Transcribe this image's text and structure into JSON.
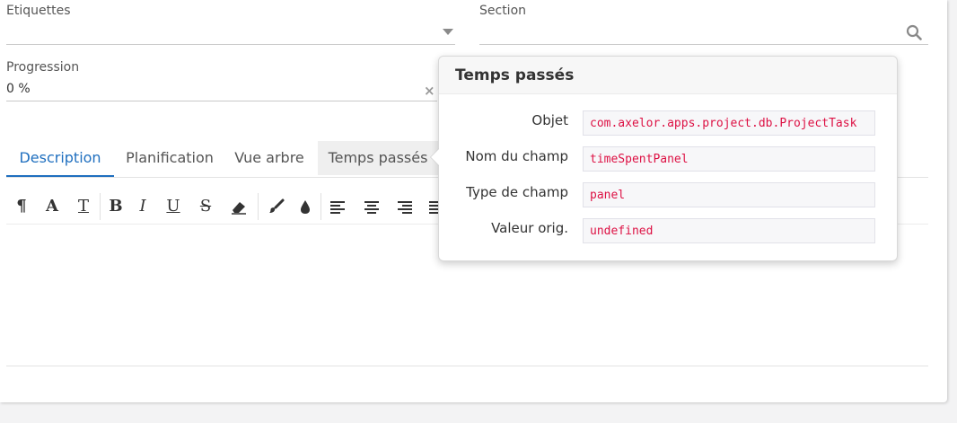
{
  "form": {
    "etiquettes": {
      "label": "Etiquettes",
      "value": ""
    },
    "section": {
      "label": "Section",
      "value": ""
    },
    "progression": {
      "label": "Progression",
      "value": "0 %"
    }
  },
  "tabs": [
    {
      "label": "Description",
      "active": true
    },
    {
      "label": "Planification",
      "active": false
    },
    {
      "label": "Vue arbre",
      "active": false
    },
    {
      "label": "Temps passés",
      "active": false,
      "hover": true
    }
  ],
  "toolbar": {
    "buttons": [
      {
        "name": "paragraph",
        "glyph": "¶"
      },
      {
        "name": "font",
        "glyph": "A"
      },
      {
        "name": "text-style",
        "glyph": "T"
      },
      {
        "name": "bold",
        "glyph": "B"
      },
      {
        "name": "italic",
        "glyph": "I"
      },
      {
        "name": "underline",
        "glyph": "U"
      },
      {
        "name": "strikethrough",
        "glyph": "S"
      },
      {
        "name": "eraser",
        "glyph": ""
      },
      {
        "name": "brush",
        "glyph": ""
      },
      {
        "name": "color-drop",
        "glyph": ""
      },
      {
        "name": "align-left",
        "glyph": ""
      },
      {
        "name": "align-center",
        "glyph": ""
      },
      {
        "name": "align-right",
        "glyph": ""
      },
      {
        "name": "justify",
        "glyph": ""
      }
    ]
  },
  "popover": {
    "title": "Temps passés",
    "rows": [
      {
        "label": "Objet",
        "value": "com.axelor.apps.project.db.ProjectTask"
      },
      {
        "label": "Nom du champ",
        "value": "timeSpentPanel"
      },
      {
        "label": "Type de champ",
        "value": "panel"
      },
      {
        "label": "Valeur orig.",
        "value": "undefined"
      }
    ]
  },
  "colors": {
    "accent": "#1f6fbf",
    "code": "#dd1144"
  }
}
